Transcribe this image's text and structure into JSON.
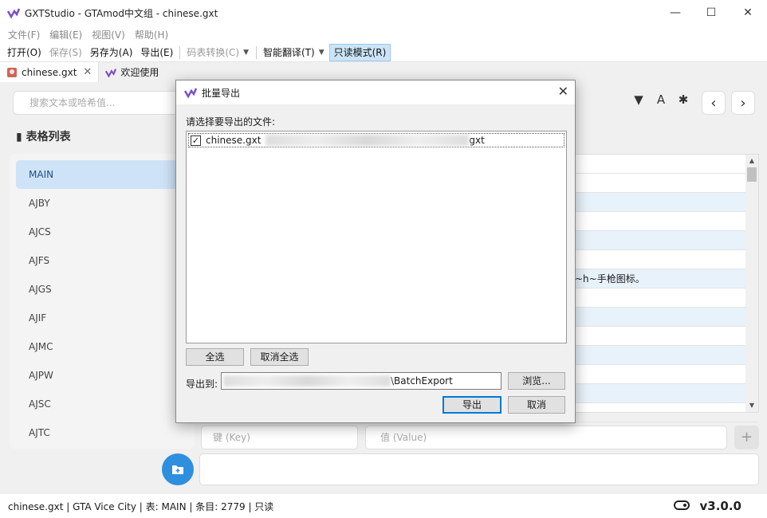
{
  "window": {
    "title": "GXTStudio - GTAmod中文组 - chinese.gxt"
  },
  "menu": [
    "文件(F)",
    "编辑(E)",
    "视图(V)",
    "帮助(H)"
  ],
  "toolbar": {
    "open": "打开(O)",
    "save": "保存(S)",
    "save_as": "另存为(A)",
    "export": "导出(E)",
    "convert": "码表转换(C)",
    "translate": "智能翻译(T)",
    "readonly": "只读模式(R)"
  },
  "tabs": [
    {
      "label": "chinese.gxt"
    },
    {
      "label": "欢迎使用"
    }
  ],
  "search": {
    "placeholder": "搜索文本或哈希值..."
  },
  "list": {
    "title": "表格列表",
    "items": [
      "MAIN",
      "AJBY",
      "AJCS",
      "AJFS",
      "AJGS",
      "AJIF",
      "AJMC",
      "AJPW",
      "AJSC",
      "AJTC"
    ]
  },
  "table": {
    "partial_text": "~h~手枪图标。"
  },
  "editor": {
    "key_placeholder": "键 (Key)",
    "value_placeholder": "值 (Value)"
  },
  "status": {
    "text": "chinese.gxt | GTA Vice City | 表: MAIN | 条目: 2779 | 只读",
    "version": "v3.0.0"
  },
  "dialog": {
    "title": "批量导出",
    "prompt": "请选择要导出的文件:",
    "file_prefix": "chinese.gxt",
    "file_suffix": "gxt",
    "select_all": "全选",
    "deselect_all": "取消全选",
    "export_to": "导出到:",
    "path_suffix": "\\BatchExport",
    "browse": "浏览...",
    "ok": "导出",
    "cancel": "取消"
  },
  "colors": {
    "accent": "#2e8fde",
    "selected": "#cfe3f8",
    "row_alt": "#e8f2fb"
  }
}
